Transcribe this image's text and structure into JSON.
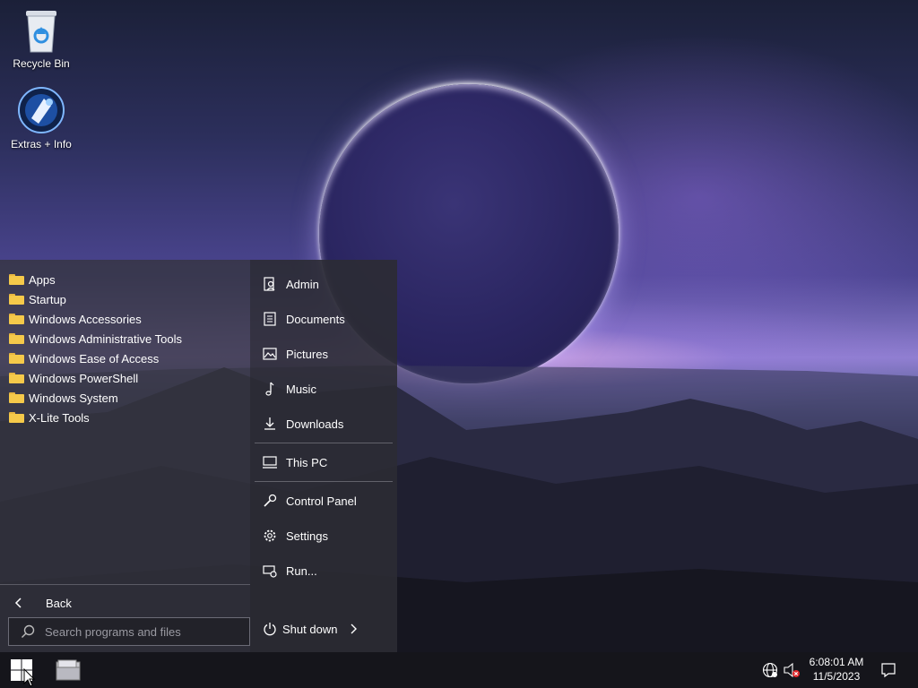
{
  "desktop": {
    "icons": [
      {
        "label": "Recycle Bin",
        "icon": "recycle-bin-icon"
      },
      {
        "label": "Extras + Info",
        "icon": "extras-info-icon"
      }
    ]
  },
  "start_menu": {
    "folders": [
      {
        "label": "Apps"
      },
      {
        "label": "Startup"
      },
      {
        "label": "Windows Accessories"
      },
      {
        "label": "Windows Administrative Tools"
      },
      {
        "label": "Windows Ease of Access"
      },
      {
        "label": "Windows PowerShell"
      },
      {
        "label": "Windows System"
      },
      {
        "label": "X-Lite Tools"
      }
    ],
    "places": [
      {
        "label": "Admin",
        "icon": "user-icon"
      },
      {
        "label": "Documents",
        "icon": "document-icon"
      },
      {
        "label": "Pictures",
        "icon": "picture-icon"
      },
      {
        "label": "Music",
        "icon": "music-note-icon"
      },
      {
        "label": "Downloads",
        "icon": "download-icon"
      },
      {
        "label": "This PC",
        "icon": "computer-icon"
      },
      {
        "label": "Control Panel",
        "icon": "wrench-icon"
      },
      {
        "label": "Settings",
        "icon": "gear-icon"
      },
      {
        "label": "Run...",
        "icon": "run-icon"
      }
    ],
    "back_label": "Back",
    "search_placeholder": "Search programs and files",
    "shutdown_label": "Shut down"
  },
  "taskbar": {
    "time": "6:08:01 AM",
    "date": "11/5/2023",
    "colors": {
      "taskbar_bg": "#15151b",
      "menu_bg": "#34343e"
    }
  }
}
